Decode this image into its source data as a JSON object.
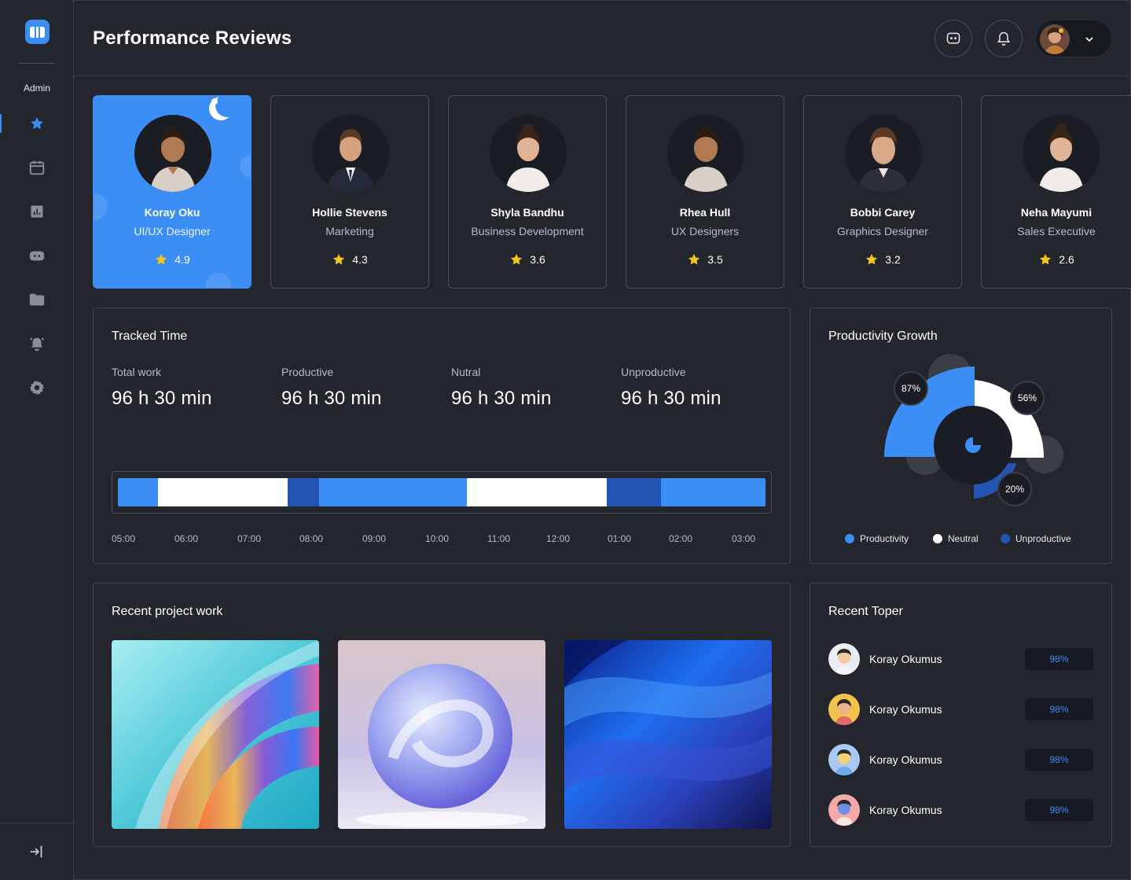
{
  "sidebar": {
    "role_label": "Admin",
    "items": [
      {
        "icon": "star-icon",
        "active": true
      },
      {
        "icon": "calendar-icon"
      },
      {
        "icon": "chart-icon"
      },
      {
        "icon": "gamepad-icon"
      },
      {
        "icon": "folder-icon"
      },
      {
        "icon": "alarm-icon"
      },
      {
        "icon": "settings-icon"
      }
    ],
    "logout_icon": "logout-icon"
  },
  "header": {
    "title": "Performance Reviews",
    "icons": [
      "chat-icon",
      "bell-icon",
      "chevron-down-icon"
    ]
  },
  "employees": [
    {
      "name": "Koray Oku",
      "role": "UI/UX Designer",
      "rating": "4.9",
      "selected": true
    },
    {
      "name": "Hollie Stevens",
      "role": "Marketing",
      "rating": "4.3"
    },
    {
      "name": "Shyla Bandhu",
      "role": "Business Development",
      "rating": "3.6"
    },
    {
      "name": "Rhea Hull",
      "role": "UX Designers",
      "rating": "3.5"
    },
    {
      "name": "Bobbi Carey",
      "role": "Graphics Designer",
      "rating": "3.2"
    },
    {
      "name": "Neha Mayumi",
      "role": "Sales Executive",
      "rating": "2.6"
    }
  ],
  "tracked_time": {
    "title": "Tracked Time",
    "stats": [
      {
        "label": "Total work",
        "value": "96 h 30 min"
      },
      {
        "label": "Productive",
        "value": "96 h 30 min"
      },
      {
        "label": "Nutral",
        "value": "96 h 30 min"
      },
      {
        "label": "Unproductive",
        "value": "96 h 30 min"
      }
    ],
    "ticks": [
      "05:00",
      "06:00",
      "07:00",
      "08:00",
      "09:00",
      "10:00",
      "11:00",
      "12:00",
      "01:00",
      "02:00",
      "03:00"
    ]
  },
  "productivity": {
    "title": "Productivity Growth",
    "values": {
      "productivity": "87%",
      "neutral": "56%",
      "unproductive": "20%"
    },
    "legend": [
      "Productivity",
      "Neutral",
      "Unproductive"
    ],
    "colors": {
      "productivity": "#3a8ef6",
      "neutral": "#ffffff",
      "unproductive": "#2354b3"
    }
  },
  "recent_projects": {
    "title": "Recent project work"
  },
  "recent_toper": {
    "title": "Recent Toper",
    "rows": [
      {
        "name": "Koray Okumus",
        "score": "98%"
      },
      {
        "name": "Koray Okumus",
        "score": "98%"
      },
      {
        "name": "Koray Okumus",
        "score": "98%"
      },
      {
        "name": "Koray Okumus",
        "score": "98%"
      }
    ]
  },
  "colors": {
    "accent": "#3a8ef6",
    "background": "#23272d",
    "star": "#f5c518"
  }
}
